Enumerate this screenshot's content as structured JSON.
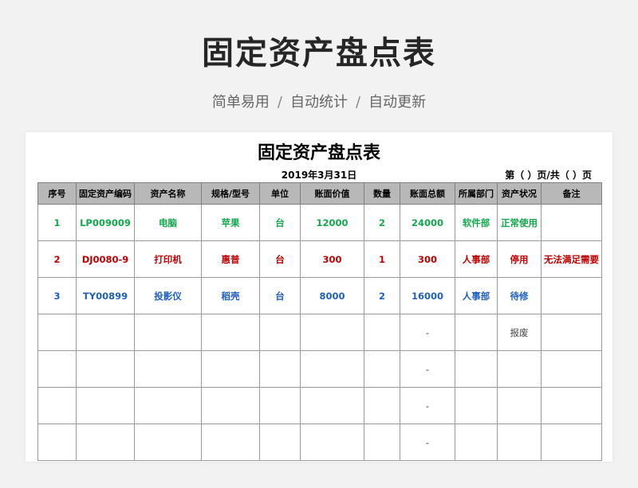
{
  "page": {
    "title": "固定资产盘点表",
    "subtitle": [
      "简单易用",
      "自动统计",
      "自动更新"
    ],
    "subtitle_sep": "/"
  },
  "sheet": {
    "title": "固定资产盘点表",
    "date": "2019年3月31日",
    "page_info": "第（ ）页/共（ ）页"
  },
  "table": {
    "headers": [
      "序号",
      "固定资产编码",
      "资产名称",
      "规格/型号",
      "单位",
      "账面价值",
      "数量",
      "账面总额",
      "所属部门",
      "资产状况",
      "备注"
    ],
    "rows": [
      [
        "1",
        "LP009009",
        "电脑",
        "苹果",
        "台",
        "12000",
        "2",
        "24000",
        "软件部",
        "正常使用",
        ""
      ],
      [
        "2",
        "DJ0080-9",
        "打印机",
        "惠普",
        "台",
        "300",
        "1",
        "300",
        "人事部",
        "停用",
        "无法满足需要"
      ],
      [
        "3",
        "TY00899",
        "投影仪",
        "稻壳",
        "台",
        "8000",
        "2",
        "16000",
        "人事部",
        "待修",
        ""
      ],
      [
        "",
        "",
        "",
        "",
        "",
        "",
        "",
        "-",
        "",
        "报废",
        ""
      ],
      [
        "",
        "",
        "",
        "",
        "",
        "",
        "",
        "-",
        "",
        "",
        ""
      ],
      [
        "",
        "",
        "",
        "",
        "",
        "",
        "",
        "-",
        "",
        "",
        ""
      ],
      [
        "",
        "",
        "",
        "",
        "",
        "",
        "",
        "-",
        "",
        "",
        ""
      ]
    ]
  },
  "colors": {
    "row1": "#12a84b",
    "row2": "#c00000",
    "row3": "#1f5fbf",
    "header_bg": "#b8b8b8"
  }
}
